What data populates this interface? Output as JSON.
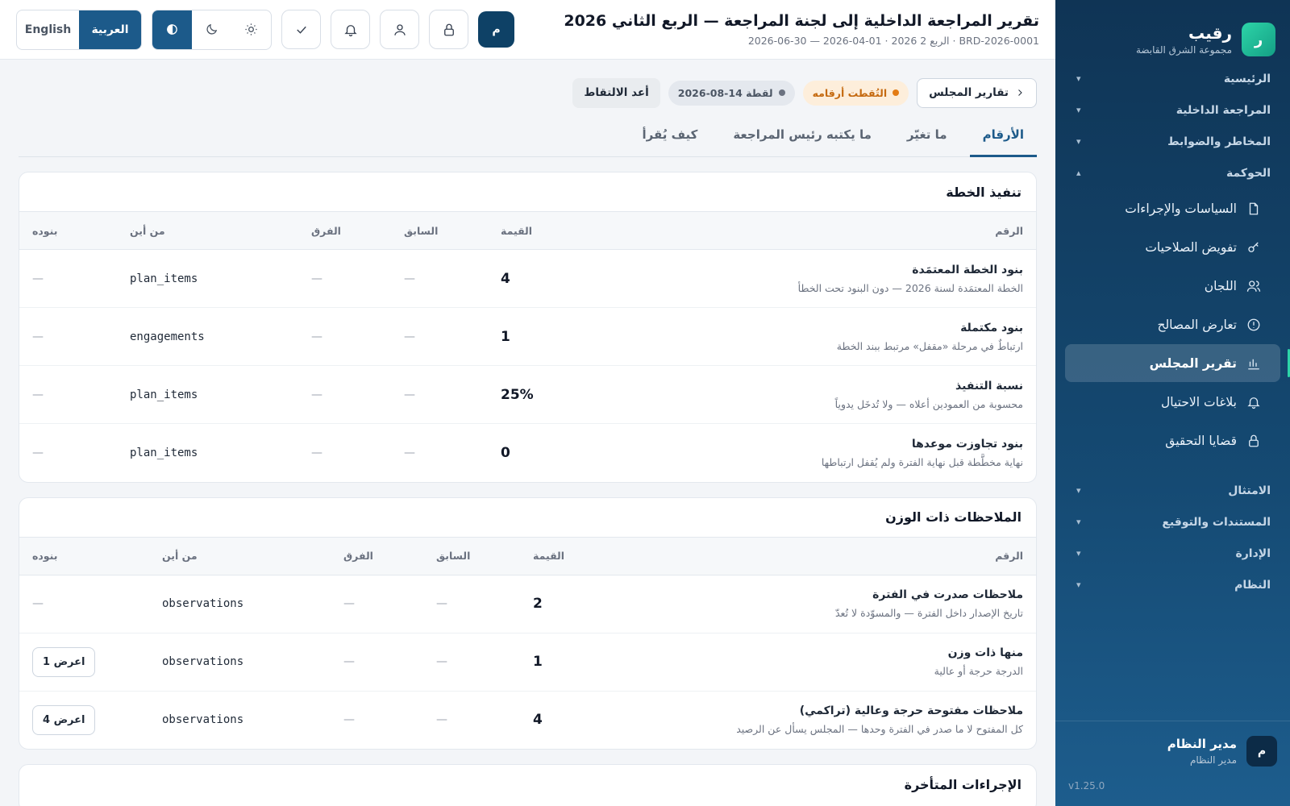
{
  "brand": {
    "logo_letter": "ر",
    "name": "رقيب",
    "org": "مجموعة الشرق القابضة"
  },
  "sidebar": {
    "groups_top": [
      {
        "label": "الرئيسية",
        "chevron": "▾"
      },
      {
        "label": "المراجعة الداخلية",
        "chevron": "▾"
      },
      {
        "label": "المخاطر والضوابط",
        "chevron": "▾"
      },
      {
        "label": "الحوكمة",
        "chevron": "▴"
      }
    ],
    "items": [
      {
        "label": "السياسات والإجراءات",
        "icon": "document-icon"
      },
      {
        "label": "تفويض الصلاحيات",
        "icon": "key-icon"
      },
      {
        "label": "اللجان",
        "icon": "users-icon"
      },
      {
        "label": "تعارض المصالح",
        "icon": "alert-circle-icon"
      },
      {
        "label": "تقرير المجلس",
        "icon": "bar-chart-icon",
        "active": true
      },
      {
        "label": "بلاغات الاحتيال",
        "icon": "bell-icon"
      },
      {
        "label": "قضايا التحقيق",
        "icon": "lock-icon"
      }
    ],
    "groups_bottom": [
      {
        "label": "الامتثال",
        "chevron": "▾"
      },
      {
        "label": "المستندات والتوقيع",
        "chevron": "▾"
      },
      {
        "label": "الإدارة",
        "chevron": "▾"
      },
      {
        "label": "النظام",
        "chevron": "▾"
      }
    ],
    "user": {
      "avatar": "م",
      "name": "مدير النظام",
      "role": "مدير النظام"
    },
    "version": "v1.25.0"
  },
  "header": {
    "title": "تقرير المراجعة الداخلية إلى لجنة المراجعة — الربع الثاني 2026",
    "meta": "BRD-2026-0001 · الربع 2 2026 · 01-04-2026 — 30-06-2026",
    "lang": {
      "ar": "العربية",
      "en": "English"
    },
    "avatar": "م"
  },
  "toolbar": {
    "back_label": "تقارير المجلس",
    "frozen_label": "التُقطت أرقامه",
    "snapshot_label": "لقطة 14-08-2026",
    "recapture_label": "أعد الالتقاط"
  },
  "tabs": [
    {
      "label": "الأرقام",
      "active": true
    },
    {
      "label": "ما تغيّر"
    },
    {
      "label": "ما يكتبه رئيس المراجعة"
    },
    {
      "label": "كيف يُقرأ"
    }
  ],
  "columns": {
    "metric": "الرقم",
    "value": "القيمة",
    "previous": "السابق",
    "diff": "الفرق",
    "source": "من أين",
    "items": "بنوده"
  },
  "plan": {
    "title": "تنفيذ الخطة",
    "rows": [
      {
        "title": "بنود الخطة المعتمَدة",
        "sub": "الخطة المعتمَدة لسنة 2026 — دون البنود تحت الخطأ",
        "value": "4",
        "previous": "—",
        "diff": "—",
        "source": "plan_items",
        "items": "—"
      },
      {
        "title": "بنود مكتملة",
        "sub": "ارتباطٌ في مرحلة «مقفل» مرتبط ببند الخطة",
        "value": "1",
        "previous": "—",
        "diff": "—",
        "source": "engagements",
        "items": "—"
      },
      {
        "title": "نسبة التنفيذ",
        "sub": "محسوبة من العمودين أعلاه — ولا تُدخَل يدوياً",
        "value": "25%",
        "previous": "—",
        "diff": "—",
        "source": "plan_items",
        "items": "—"
      },
      {
        "title": "بنود تجاوزت موعدها",
        "sub": "نهاية مخطَّطة قبل نهاية الفترة ولم يُقفل ارتباطها",
        "value": "0",
        "previous": "—",
        "diff": "—",
        "source": "plan_items",
        "items": "—"
      }
    ]
  },
  "observations": {
    "title": "الملاحظات ذات الوزن",
    "rows": [
      {
        "title": "ملاحظات صدرت في الفترة",
        "sub": "تاريخ الإصدار داخل الفترة — والمسوّدة لا تُعدّ",
        "value": "2",
        "previous": "—",
        "diff": "—",
        "source": "observations",
        "items": "—",
        "button": ""
      },
      {
        "title": "منها ذات وزن",
        "sub": "الدرجة حرجة أو عالية",
        "value": "1",
        "previous": "—",
        "diff": "—",
        "source": "observations",
        "items": "",
        "button": "اعرض 1"
      },
      {
        "title": "ملاحظات مفتوحة حرجة وعالية (تراكمي)",
        "sub": "كل المفتوح لا ما صدر في الفترة وحدها — المجلس يسأل عن الرصيد",
        "value": "4",
        "previous": "—",
        "diff": "—",
        "source": "observations",
        "items": "",
        "button": "اعرض 4"
      }
    ]
  },
  "overdue": {
    "title": "الإجراءات المتأخرة"
  }
}
